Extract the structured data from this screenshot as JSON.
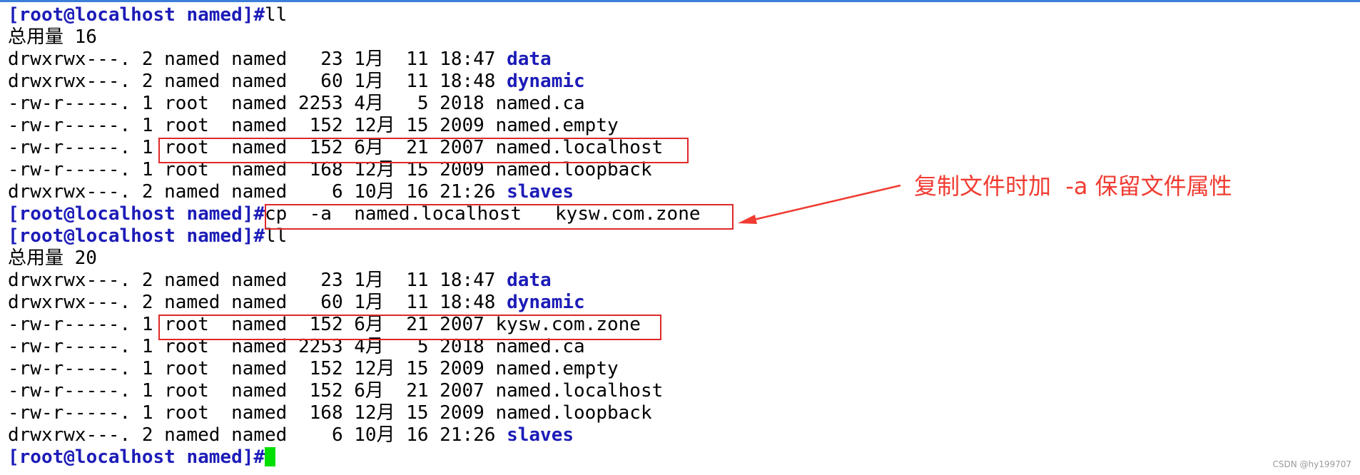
{
  "prompt": "[root@localhost named]#",
  "lines": [
    {
      "type": "prompt",
      "cmd": "ll"
    },
    {
      "type": "text",
      "text": "总用量 16"
    },
    {
      "type": "entry",
      "info": "drwxrwx---. 2 named named   23 1月  11 18:47 ",
      "name": "data",
      "is_dir": true
    },
    {
      "type": "entry",
      "info": "drwxrwx---. 2 named named   60 1月  11 18:48 ",
      "name": "dynamic",
      "is_dir": true
    },
    {
      "type": "entry",
      "info": "-rw-r-----. 1 root  named 2253 4月   5 2018 ",
      "name": "named.ca",
      "is_dir": false
    },
    {
      "type": "entry",
      "info": "-rw-r-----. 1 root  named  152 12月 15 2009 ",
      "name": "named.empty",
      "is_dir": false
    },
    {
      "type": "entry",
      "info": "-rw-r-----. 1 root  named  152 6月  21 2007 ",
      "name": "named.localhost",
      "is_dir": false
    },
    {
      "type": "entry",
      "info": "-rw-r-----. 1 root  named  168 12月 15 2009 ",
      "name": "named.loopback",
      "is_dir": false
    },
    {
      "type": "entry",
      "info": "drwxrwx---. 2 named named    6 10月 16 21:26 ",
      "name": "slaves",
      "is_dir": true
    },
    {
      "type": "prompt",
      "cmd": "cp  -a  named.localhost   kysw.com.zone"
    },
    {
      "type": "prompt",
      "cmd": "ll"
    },
    {
      "type": "text",
      "text": "总用量 20"
    },
    {
      "type": "entry",
      "info": "drwxrwx---. 2 named named   23 1月  11 18:47 ",
      "name": "data",
      "is_dir": true
    },
    {
      "type": "entry",
      "info": "drwxrwx---. 2 named named   60 1月  11 18:48 ",
      "name": "dynamic",
      "is_dir": true
    },
    {
      "type": "entry",
      "info": "-rw-r-----. 1 root  named  152 6月  21 2007 ",
      "name": "kysw.com.zone",
      "is_dir": false
    },
    {
      "type": "entry",
      "info": "-rw-r-----. 1 root  named 2253 4月   5 2018 ",
      "name": "named.ca",
      "is_dir": false
    },
    {
      "type": "entry",
      "info": "-rw-r-----. 1 root  named  152 12月 15 2009 ",
      "name": "named.empty",
      "is_dir": false
    },
    {
      "type": "entry",
      "info": "-rw-r-----. 1 root  named  152 6月  21 2007 ",
      "name": "named.localhost",
      "is_dir": false
    },
    {
      "type": "entry",
      "info": "-rw-r-----. 1 root  named  168 12月 15 2009 ",
      "name": "named.loopback",
      "is_dir": false
    },
    {
      "type": "entry",
      "info": "drwxrwx---. 2 named named    6 10月 16 21:26 ",
      "name": "slaves",
      "is_dir": true
    },
    {
      "type": "prompt",
      "cmd": "",
      "cursor": true
    }
  ],
  "annotation": "复制文件时加  -a 保留文件属性",
  "watermark": "CSDN @hy199707",
  "colors": {
    "prompt": "#1c1cb8",
    "directory": "#1c1cb8",
    "highlight": "#e02828",
    "annotation": "#f03c32",
    "cursor": "#00e000"
  }
}
